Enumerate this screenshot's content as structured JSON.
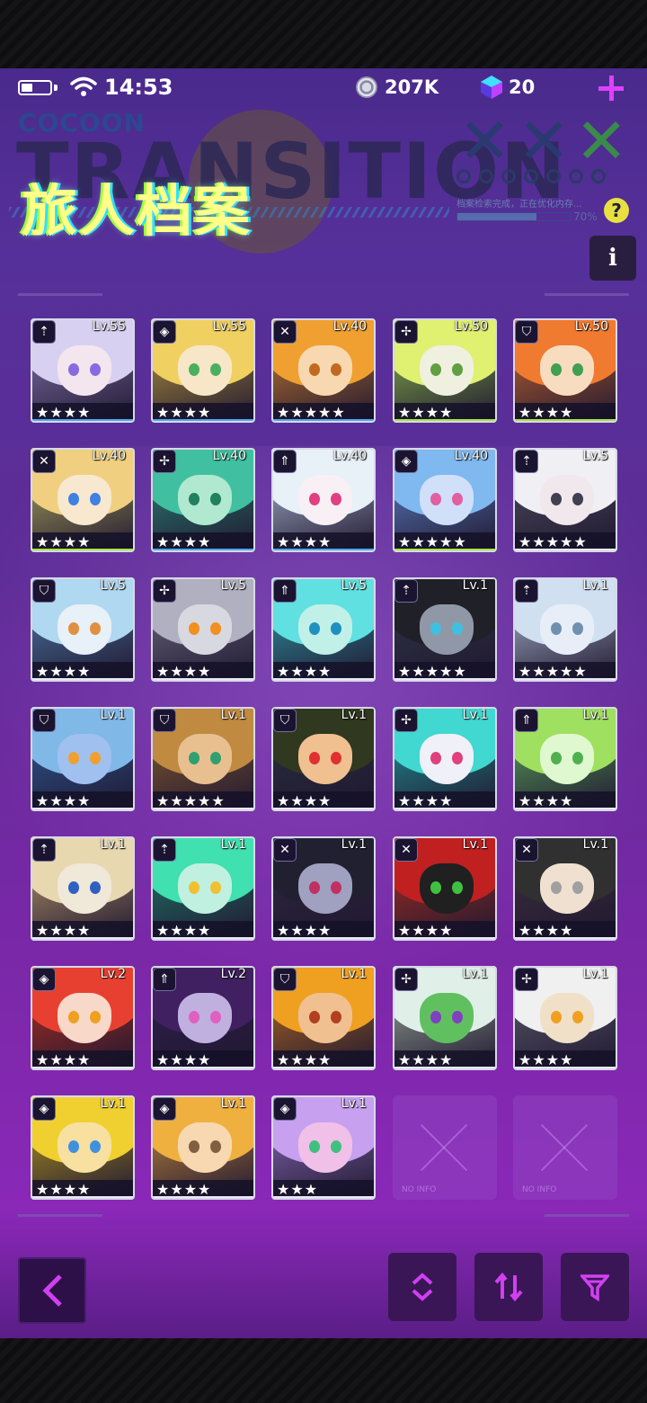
{
  "status_bar": {
    "time": "14:53",
    "coins": "207K",
    "gems": "20"
  },
  "header": {
    "brand": "COCOON",
    "bg_title": "TRANSITION",
    "title": "旅人档案",
    "progress_caption": "档案检索完成，正在优化内存...",
    "progress_fraction": 0.7,
    "progress_pct": "70%",
    "help": "?",
    "info": "i"
  },
  "colors": {
    "accent_green": "#a6e43c",
    "accent_blue": "#4aa8f0",
    "accent_magenta": "#e040ff",
    "stage_top": "#4a2a8c",
    "stage_bottom": "#8a28b8"
  },
  "characters": [
    {
      "level": "Lv.55",
      "stars": "★★★★",
      "role_icon": "spear-icon",
      "accent": "#4aa8f0"
    },
    {
      "level": "Lv.55",
      "stars": "★★★★",
      "role_icon": "diamond-icon",
      "accent": "#4aa8f0"
    },
    {
      "level": "Lv.40",
      "stars": "★★★★★",
      "role_icon": "crossed-swords-icon",
      "accent": "#4aa8f0"
    },
    {
      "level": "Lv.50",
      "stars": "★★★★",
      "role_icon": "bow-icon",
      "accent": "#a6e43c"
    },
    {
      "level": "Lv.50",
      "stars": "★★★★",
      "role_icon": "shield-icon",
      "accent": "#a6e43c"
    },
    {
      "level": "Lv.40",
      "stars": "★★★★",
      "role_icon": "crossed-swords-icon",
      "accent": "#a6e43c"
    },
    {
      "level": "Lv.40",
      "stars": "★★★★",
      "role_icon": "bow-icon",
      "accent": "#4aa8f0"
    },
    {
      "level": "Lv.40",
      "stars": "★★★★",
      "role_icon": "arrow-up-icon",
      "accent": "#4aa8f0"
    },
    {
      "level": "Lv.40",
      "stars": "★★★★★",
      "role_icon": "diamond-icon",
      "accent": "#a6e43c"
    },
    {
      "level": "Lv.5",
      "stars": "★★★★★",
      "role_icon": "spear-icon",
      "accent": "#e8e8f0"
    },
    {
      "level": "Lv.5",
      "stars": "★★★★",
      "role_icon": "shield-icon",
      "accent": "#e8e8f0"
    },
    {
      "level": "Lv.5",
      "stars": "★★★★",
      "role_icon": "bow-icon",
      "accent": "#e8e8f0"
    },
    {
      "level": "Lv.5",
      "stars": "★★★★",
      "role_icon": "arrow-up-icon",
      "accent": "#e8e8f0"
    },
    {
      "level": "Lv.1",
      "stars": "★★★★★",
      "role_icon": "spear-icon",
      "accent": "#e8e8f0"
    },
    {
      "level": "Lv.1",
      "stars": "★★★★★",
      "role_icon": "spear-icon",
      "accent": "#e8e8f0"
    },
    {
      "level": "Lv.1",
      "stars": "★★★★",
      "role_icon": "shield-icon",
      "accent": "#e8e8f0"
    },
    {
      "level": "Lv.1",
      "stars": "★★★★★",
      "role_icon": "shield-icon",
      "accent": "#e8e8f0"
    },
    {
      "level": "Lv.1",
      "stars": "★★★★",
      "role_icon": "shield-icon",
      "accent": "#e8e8f0"
    },
    {
      "level": "Lv.1",
      "stars": "★★★★",
      "role_icon": "bow-icon",
      "accent": "#e8e8f0"
    },
    {
      "level": "Lv.1",
      "stars": "★★★★",
      "role_icon": "arrow-up-icon",
      "accent": "#e8e8f0"
    },
    {
      "level": "Lv.1",
      "stars": "★★★★",
      "role_icon": "spear-icon",
      "accent": "#e8e8f0"
    },
    {
      "level": "Lv.1",
      "stars": "★★★★",
      "role_icon": "spear-icon",
      "accent": "#e8e8f0"
    },
    {
      "level": "Lv.1",
      "stars": "★★★★",
      "role_icon": "crossed-swords-icon",
      "accent": "#e8e8f0"
    },
    {
      "level": "Lv.1",
      "stars": "★★★★",
      "role_icon": "crossed-swords-icon",
      "accent": "#e8e8f0"
    },
    {
      "level": "Lv.1",
      "stars": "★★★★",
      "role_icon": "crossed-swords-icon",
      "accent": "#e8e8f0"
    },
    {
      "level": "Lv.2",
      "stars": "★★★★",
      "role_icon": "diamond-icon",
      "accent": "#e8e8f0"
    },
    {
      "level": "Lv.2",
      "stars": "★★★★",
      "role_icon": "arrow-up-icon",
      "accent": "#e8e8f0"
    },
    {
      "level": "Lv.1",
      "stars": "★★★★",
      "role_icon": "shield-icon",
      "accent": "#e8e8f0"
    },
    {
      "level": "Lv.1",
      "stars": "★★★★",
      "role_icon": "bow-icon",
      "accent": "#e8e8f0"
    },
    {
      "level": "Lv.1",
      "stars": "★★★★",
      "role_icon": "bow-icon",
      "accent": "#e8e8f0"
    },
    {
      "level": "Lv.1",
      "stars": "★★★★",
      "role_icon": "diamond-icon",
      "accent": "#e8e8f0"
    },
    {
      "level": "Lv.1",
      "stars": "★★★★",
      "role_icon": "diamond-icon",
      "accent": "#e8e8f0"
    },
    {
      "level": "Lv.1",
      "stars": "★★★",
      "role_icon": "diamond-icon",
      "accent": "#e8e8f0"
    }
  ],
  "empty_slots": [
    {
      "label": "NO INFO"
    },
    {
      "label": "NO INFO"
    }
  ],
  "bottom_buttons": [
    {
      "name": "back-button",
      "icon": "chevron-left-icon"
    },
    {
      "name": "sort-order-button",
      "icon": "sort-updown-icon"
    },
    {
      "name": "swap-sort-button",
      "icon": "arrows-updown-icon"
    },
    {
      "name": "filter-button",
      "icon": "filter-icon"
    }
  ]
}
